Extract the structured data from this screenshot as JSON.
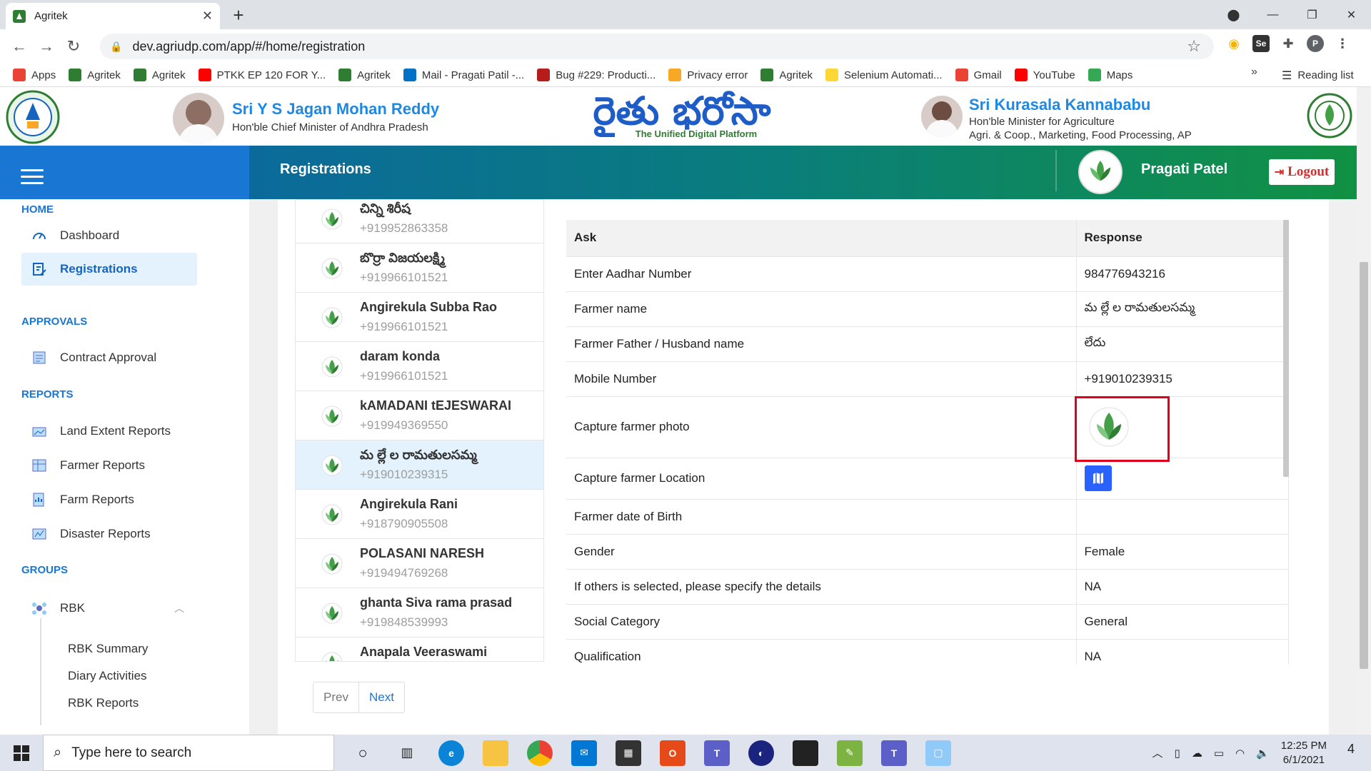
{
  "browser": {
    "tab_title": "Agritek",
    "url": "dev.agriudp.com/app/#/home/registration",
    "bookmarks": [
      {
        "label": "Apps",
        "color": "#ea4335"
      },
      {
        "label": "Agritek",
        "color": "#2e7d32"
      },
      {
        "label": "Agritek",
        "color": "#2e7d32"
      },
      {
        "label": "PTKK EP 120 FOR Y...",
        "color": "#ff0000"
      },
      {
        "label": "Agritek",
        "color": "#2e7d32"
      },
      {
        "label": "Mail - Pragati Patil -...",
        "color": "#0072c6"
      },
      {
        "label": "Bug #229: Producti...",
        "color": "#b71c1c"
      },
      {
        "label": "Privacy error",
        "color": "#f9a825"
      },
      {
        "label": "Agritek",
        "color": "#2e7d32"
      },
      {
        "label": "Selenium Automati...",
        "color": "#fdd835"
      },
      {
        "label": "Gmail",
        "color": "#ea4335"
      },
      {
        "label": "YouTube",
        "color": "#ff0000"
      },
      {
        "label": "Maps",
        "color": "#34a853"
      }
    ],
    "more": "»",
    "reading_list": "Reading list",
    "profile_initial": "P"
  },
  "header": {
    "cm_name": "Sri Y S Jagan Mohan Reddy",
    "cm_role": "Hon'ble Chief Minister of Andhra Pradesh",
    "logo_text": "రైతు భరోసా",
    "logo_tagline": "The Unified Digital Platform",
    "minister_name": "Sri Kurasala Kannababu",
    "minister_role1": "Hon'ble Minister for Agriculture",
    "minister_role2": "Agri. & Coop., Marketing, Food Processing, AP"
  },
  "nav": {
    "page_title": "Registrations",
    "user_name": "Pragati Patel",
    "logout": "Logout"
  },
  "sidebar": {
    "home": "HOME",
    "dashboard": "Dashboard",
    "registrations": "Registrations",
    "approvals": "APPROVALS",
    "contract_approval": "Contract Approval",
    "reports": "REPORTS",
    "land_extent": "Land Extent Reports",
    "farmer_reports": "Farmer Reports",
    "farm_reports": "Farm Reports",
    "disaster_reports": "Disaster Reports",
    "groups": "GROUPS",
    "rbk": "RBK",
    "rbk_summary": "RBK Summary",
    "diary": "Diary Activities",
    "rbk_reports": "RBK Reports"
  },
  "farmers": [
    {
      "name": "చిన్ని శిరీష",
      "phone": "+919952863358"
    },
    {
      "name": "బొర్రా విజయలక్ష్మి",
      "phone": "+919966101521"
    },
    {
      "name": "Angirekula Subba Rao",
      "phone": "+919966101521"
    },
    {
      "name": "daram konda",
      "phone": "+919966101521"
    },
    {
      "name": "kAMADANI tEJESWARAI",
      "phone": "+919949369550"
    },
    {
      "name": "మ ల్లే ల రామతులసమ్మ",
      "phone": "+919010239315"
    },
    {
      "name": "Angirekula Rani",
      "phone": "+918790905508"
    },
    {
      "name": "POLASANI NARESH",
      "phone": "+919494769268"
    },
    {
      "name": "ghanta Siva rama prasad",
      "phone": "+919848539993"
    },
    {
      "name": "Anapala Veeraswami",
      "phone": ""
    }
  ],
  "pager": {
    "prev": "Prev",
    "next": "Next"
  },
  "details": {
    "col_ask": "Ask",
    "col_response": "Response",
    "rows": [
      {
        "ask": "Enter Aadhar Number",
        "response": "984776943216"
      },
      {
        "ask": "Farmer name",
        "response": "మ ల్లే ల రామతులసమ్మ"
      },
      {
        "ask": "Farmer Father / Husband name",
        "response": "లేదు"
      },
      {
        "ask": "Mobile Number",
        "response": "+919010239315"
      },
      {
        "ask": "Capture farmer photo",
        "response": ""
      },
      {
        "ask": "Capture farmer Location",
        "response": ""
      },
      {
        "ask": "Farmer date of Birth",
        "response": ""
      },
      {
        "ask": "Gender",
        "response": "Female"
      },
      {
        "ask": "If others is selected, please specify the details",
        "response": "NA"
      },
      {
        "ask": "Social Category",
        "response": "General"
      },
      {
        "ask": "Qualification",
        "response": "NA"
      }
    ]
  },
  "taskbar": {
    "search_placeholder": "Type here to search",
    "time": "12:25 PM",
    "date": "6/1/2021",
    "notifications": "4"
  }
}
